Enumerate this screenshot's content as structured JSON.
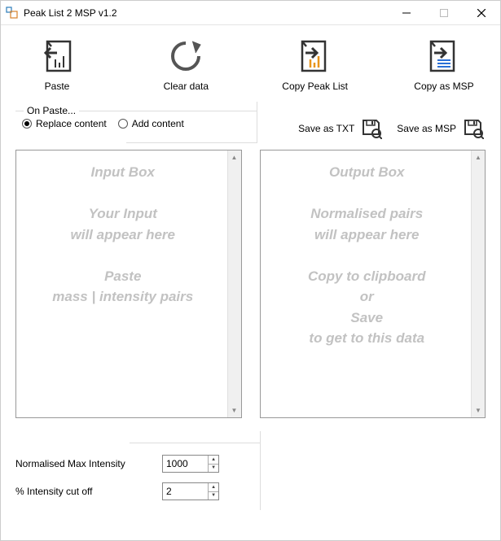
{
  "window": {
    "title": "Peak List 2 MSP v1.2"
  },
  "toolbar": {
    "paste": "Paste",
    "clear": "Clear data",
    "copy_peak": "Copy Peak List",
    "copy_msp": "Copy as MSP"
  },
  "on_paste": {
    "legend": "On Paste...",
    "replace": "Replace content",
    "add": "Add content",
    "selected": "replace"
  },
  "save": {
    "txt": "Save as TXT",
    "msp": "Save as MSP"
  },
  "input_box": {
    "placeholder": "Input Box\n\nYour Input\nwill appear here\n\nPaste\nmass | intensity pairs"
  },
  "output_box": {
    "placeholder": "Output  Box\n\nNormalised pairs\nwill appear here\n\nCopy to clipboard\nor\nSave\nto get to this data"
  },
  "fields": {
    "max_intensity_label": "Normalised Max Intensity",
    "max_intensity_value": "1000",
    "cutoff_label": "% Intensity cut off",
    "cutoff_value": "2"
  }
}
